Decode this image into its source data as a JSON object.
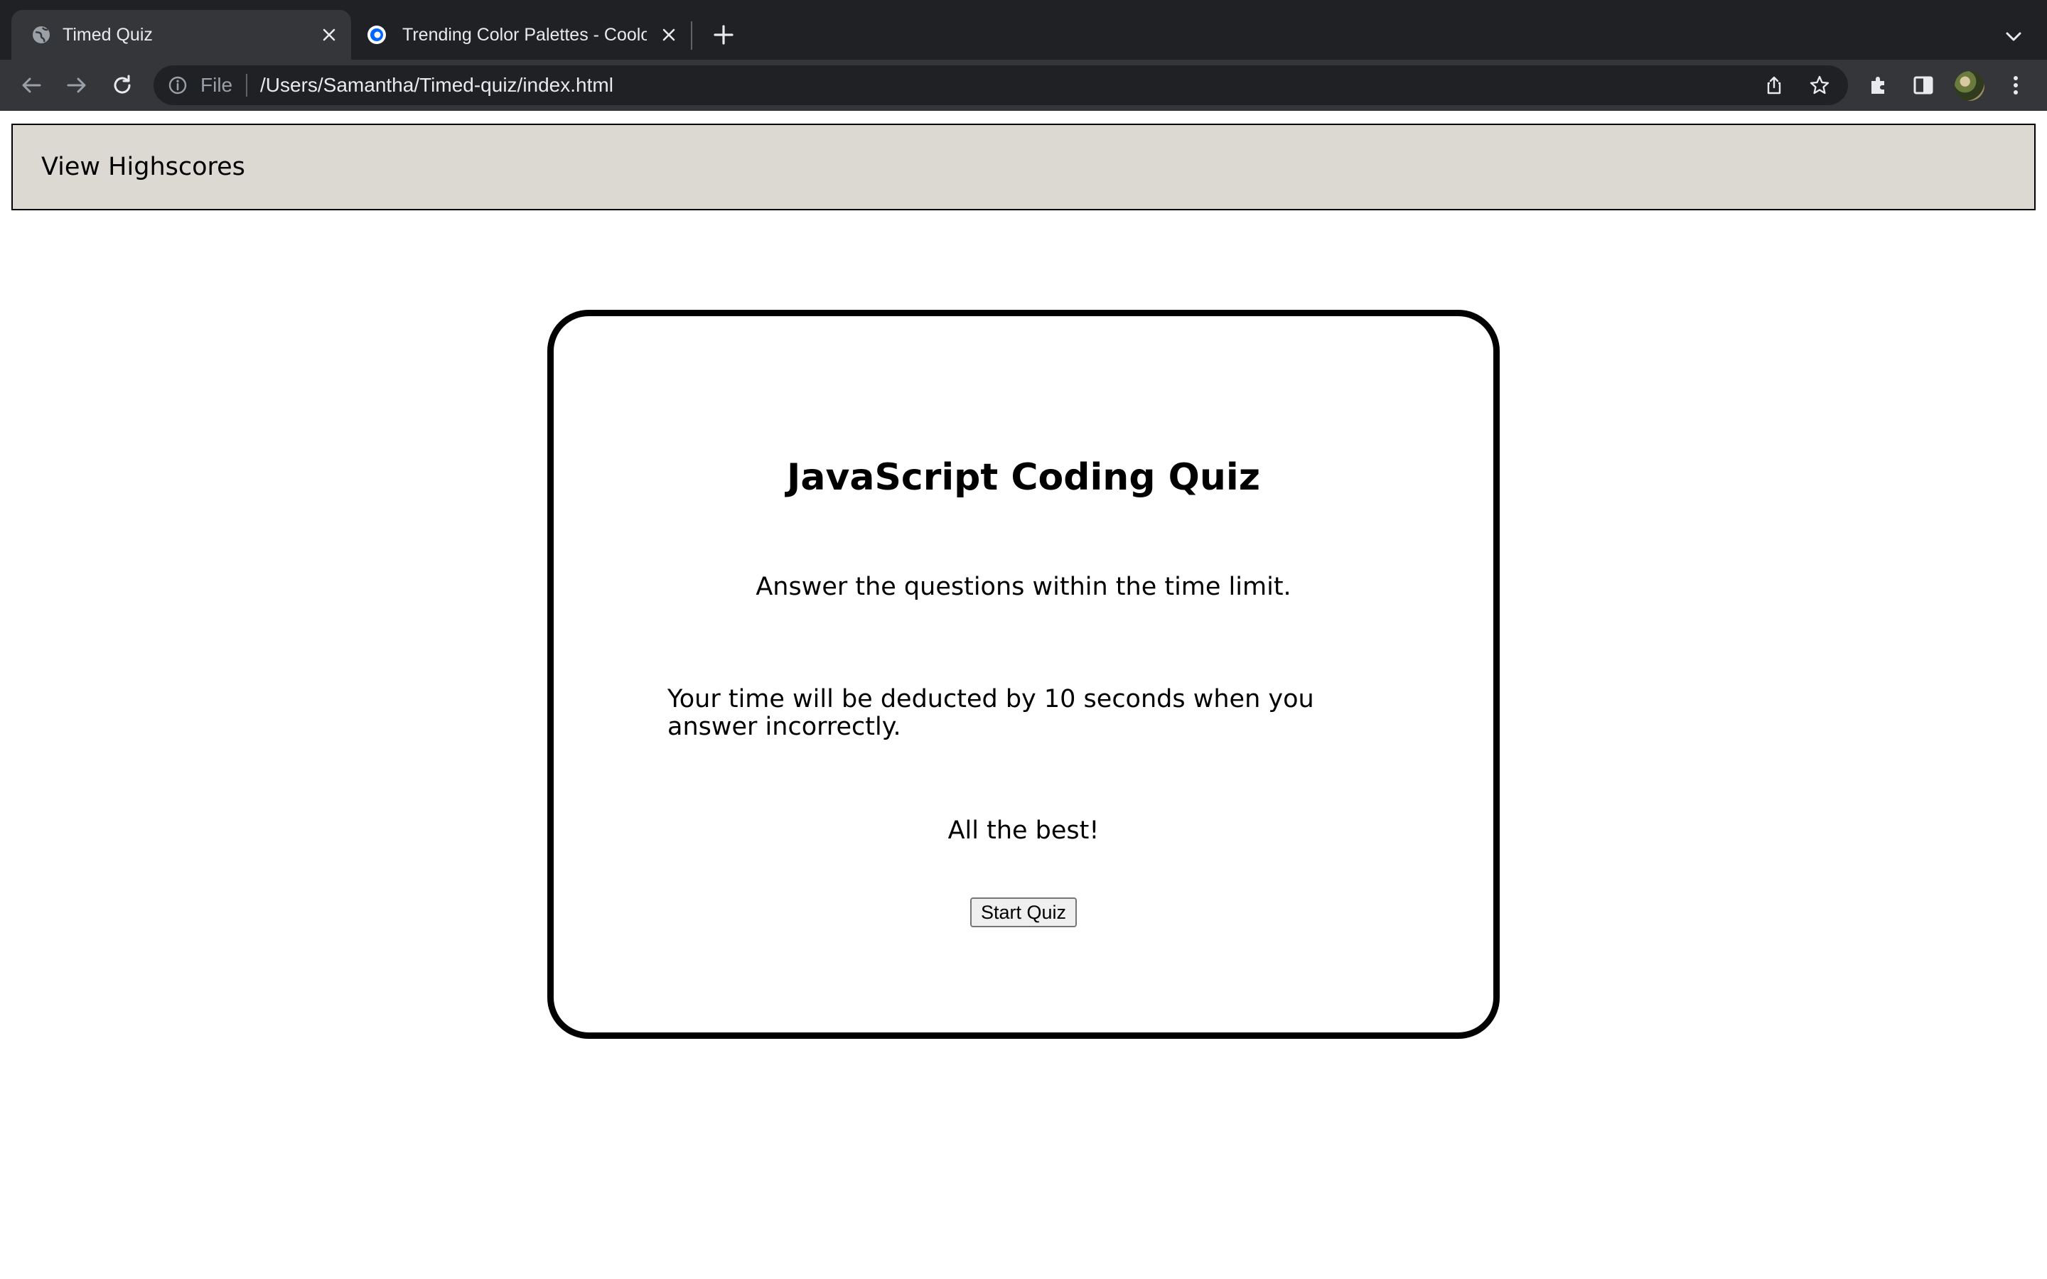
{
  "browser": {
    "tabs": [
      {
        "title": "Timed Quiz",
        "active": true,
        "favicon": "globe-icon"
      },
      {
        "title": "Trending Color Palettes - Coolors",
        "active": false,
        "favicon": "coolors-icon"
      }
    ],
    "address_bar": {
      "scheme_label": "File",
      "url": "/Users/Samantha/Timed-quiz/index.html"
    },
    "colors": {
      "tabstrip_bg": "#202124",
      "toolbar_bg": "#35363a",
      "omnibox_bg": "#202124"
    }
  },
  "page": {
    "header": {
      "highscores_label": "View Highscores",
      "background": "#dcd9d2"
    },
    "quiz": {
      "title": "JavaScript Coding Quiz",
      "instruction_1": "Answer the questions within the time limit.",
      "instruction_2": "Your time will be deducted by 10 seconds when you answer incorrectly.",
      "instruction_3": "All the best!",
      "start_button_label": "Start Quiz"
    }
  }
}
